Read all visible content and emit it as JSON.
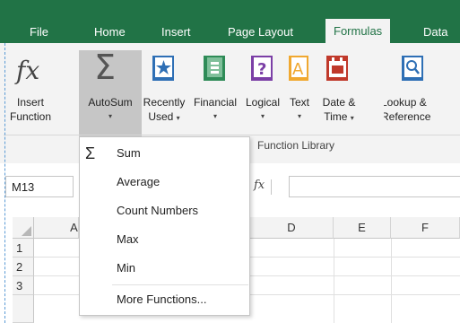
{
  "tabs": [
    {
      "label": "File"
    },
    {
      "label": "Home"
    },
    {
      "label": "Insert"
    },
    {
      "label": "Page Layout"
    },
    {
      "label": "Formulas",
      "active": true
    },
    {
      "label": "Data"
    }
  ],
  "ribbon": {
    "insert_function": {
      "line1": "Insert",
      "line2": "Function",
      "icon": "fx-icon"
    },
    "autosum": {
      "line1": "AutoSum",
      "arrow": "▾",
      "icon": "sigma-icon"
    },
    "recently_used": {
      "line1": "Recently",
      "line2": "Used",
      "arrow": "▾",
      "icon": "star-book-icon"
    },
    "financial": {
      "line1": "Financial",
      "arrow": "▾",
      "icon": "financial-book-icon"
    },
    "logical": {
      "line1": "Logical",
      "arrow": "▾",
      "icon": "question-book-icon"
    },
    "text": {
      "line1": "Text",
      "arrow": "▾",
      "icon": "text-book-icon"
    },
    "date_time": {
      "line1": "Date &",
      "line2": "Time",
      "arrow": "▾",
      "icon": "calendar-book-icon"
    },
    "lookup": {
      "line1": "Lookup &",
      "line2": "Reference",
      "icon": "search-book-icon"
    },
    "group_label": "Function Library"
  },
  "formula_bar": {
    "name_box": "M13",
    "fx_label": "fx"
  },
  "grid": {
    "columns": [
      "A",
      "D",
      "E",
      "F"
    ],
    "rows": [
      "1",
      "2",
      "3"
    ]
  },
  "menu": {
    "items": [
      {
        "label": "Sum"
      },
      {
        "label": "Average"
      },
      {
        "label": "Count Numbers"
      },
      {
        "label": "Max"
      },
      {
        "label": "Min"
      },
      {
        "label": "More Functions..."
      }
    ]
  },
  "colors": {
    "accent": "#217346",
    "ribbon_bg": "#f3f3f3",
    "hover": "#c6c6c6"
  }
}
